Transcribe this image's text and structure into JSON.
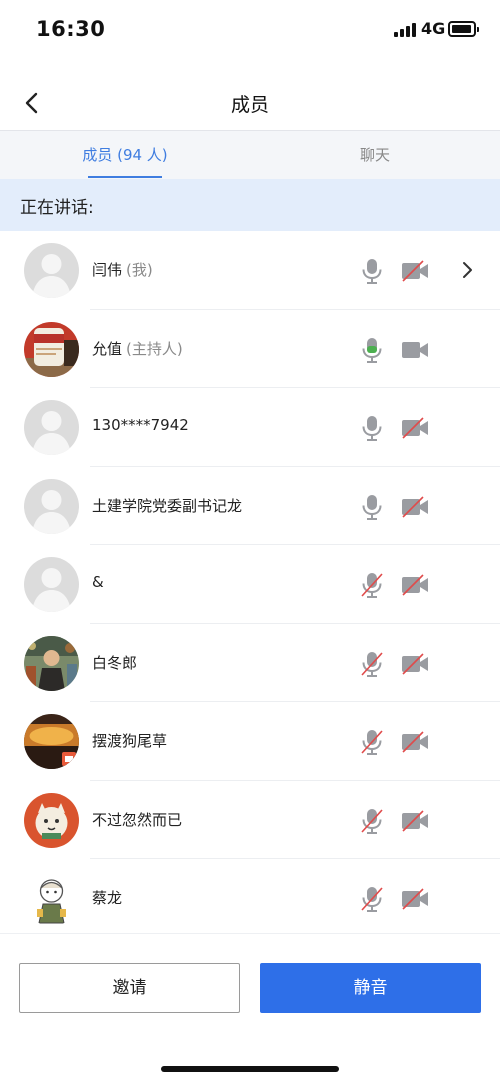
{
  "status_bar": {
    "time": "16:30",
    "network": "4G"
  },
  "nav": {
    "title": "成员",
    "back_icon": "chevron-left-icon"
  },
  "tabs": [
    {
      "label": "成员 (94 人)",
      "active": true
    },
    {
      "label": "聊天",
      "active": false
    }
  ],
  "speaking": {
    "label": "正在讲话:"
  },
  "members": [
    {
      "name": "闫伟",
      "role": "(我)",
      "avatar": "default",
      "mic": "off",
      "cam": "off",
      "has_arrow": true
    },
    {
      "name": "允值",
      "role": "(主持人)",
      "avatar": "photo-can",
      "mic": "on",
      "cam": "on",
      "has_arrow": false
    },
    {
      "name": "130****7942",
      "role": "",
      "avatar": "default",
      "mic": "off",
      "cam": "off",
      "has_arrow": false
    },
    {
      "name": "土建学院党委副书记龙",
      "role": "",
      "avatar": "default",
      "mic": "off",
      "cam": "off",
      "has_arrow": false
    },
    {
      "name": "&",
      "role": "",
      "avatar": "default",
      "mic": "disabled",
      "cam": "off",
      "has_arrow": false
    },
    {
      "name": "白冬郎",
      "role": "",
      "avatar": "photo-illustration",
      "mic": "disabled",
      "cam": "off",
      "has_arrow": false
    },
    {
      "name": "摆渡狗尾草",
      "role": "",
      "avatar": "photo-sunset",
      "mic": "disabled",
      "cam": "off",
      "has_arrow": false
    },
    {
      "name": "不过忽然而已",
      "role": "",
      "avatar": "photo-cartoon-cat",
      "mic": "disabled",
      "cam": "off",
      "has_arrow": false
    },
    {
      "name": "蔡龙",
      "role": "",
      "avatar": "photo-cartoon-person",
      "mic": "disabled",
      "cam": "off",
      "has_arrow": false
    }
  ],
  "buttons": {
    "invite": "邀请",
    "mute": "静音"
  },
  "colors": {
    "accent": "#2e6fe8",
    "tab_active": "#3f7de0",
    "banner": "#e3edfb",
    "mic_on": "#4caf50",
    "slash": "#e04b4b",
    "icon_gray": "#9a9ca1"
  }
}
